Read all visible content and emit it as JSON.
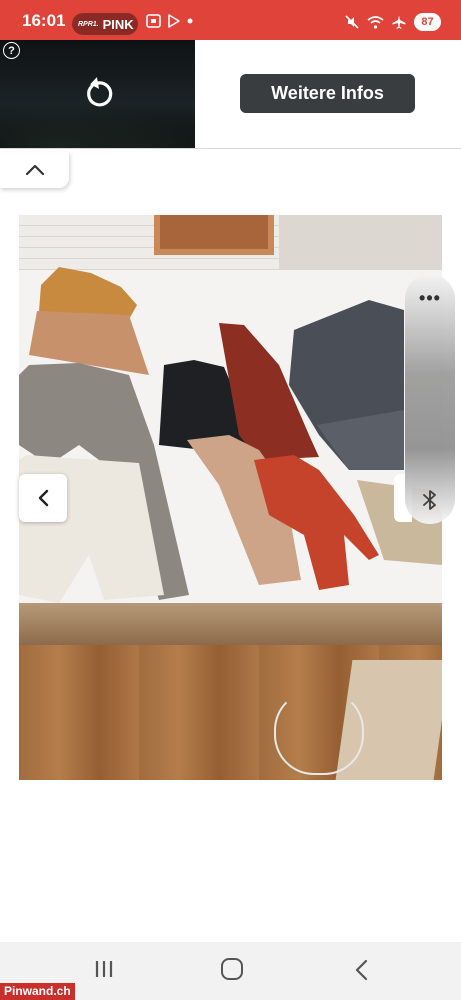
{
  "status_bar": {
    "time": "16:01",
    "radio_logo": "RPR1.",
    "radio_name": "PINK",
    "battery": "87",
    "background": "#e0433a"
  },
  "ad": {
    "help_icon": "?",
    "cta_label": "Weitere Infos",
    "icons": [
      "help-icon",
      "replay-icon"
    ]
  },
  "carousel": {
    "collapse_icon": "chevron-up-icon",
    "prev_icon": "chevron-left-icon"
  },
  "edge_panel": {
    "menu_label": "•••",
    "icon": "bluetooth-icon"
  },
  "nav": {
    "icons": [
      "recents-icon",
      "home-icon",
      "back-icon"
    ]
  },
  "watermark": {
    "text": "Pinwand.ch"
  }
}
